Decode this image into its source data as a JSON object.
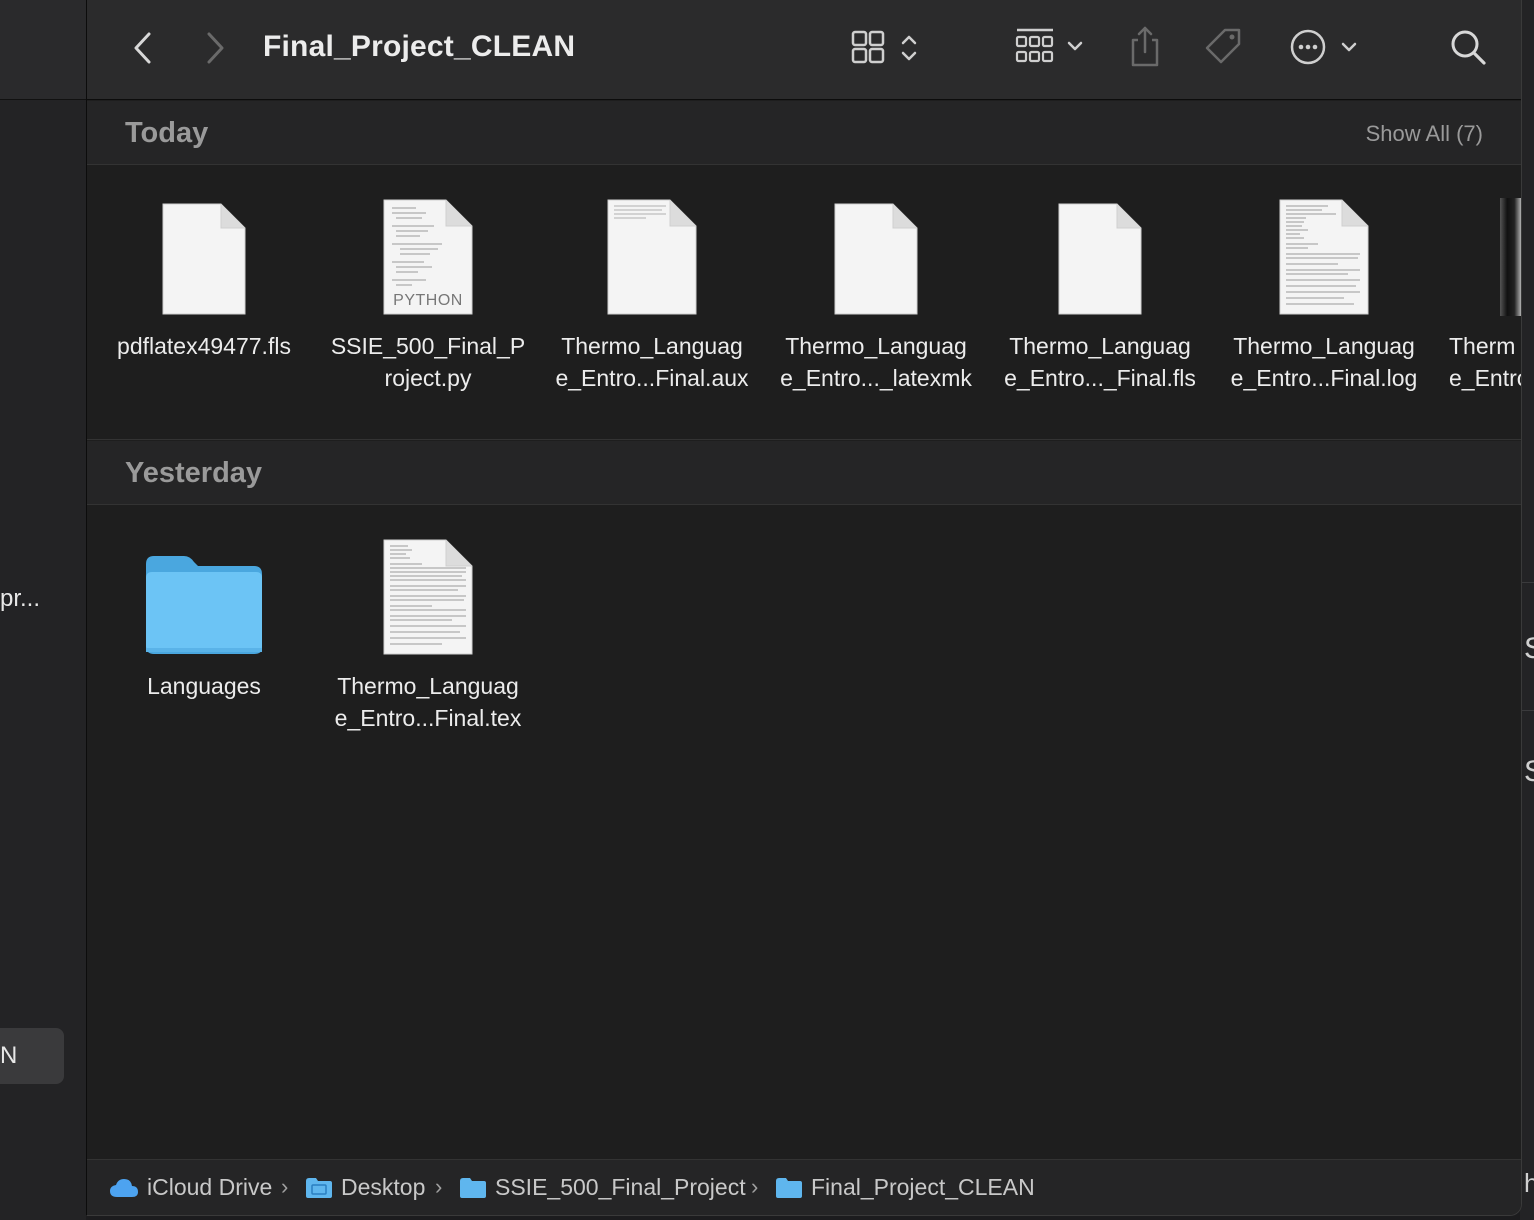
{
  "window": {
    "title": "Final_Project_CLEAN"
  },
  "toolbar": {
    "back": "back-icon",
    "forward": "forward-icon",
    "view_mode": "icon-view-icon",
    "group_by": "group-by-icon",
    "share": "share-icon",
    "tags": "tag-icon",
    "more": "more-icon",
    "search": "search-icon"
  },
  "sections": {
    "today": {
      "label": "Today",
      "show_all": "Show All (7)",
      "items": [
        {
          "line1": "pdflatex49477.fls",
          "line2": "",
          "kind": "blank-doc"
        },
        {
          "line1": "SSIE_500_Final_P",
          "line2": "roject.py",
          "kind": "python-doc",
          "badge": "PYTHON"
        },
        {
          "line1": "Thermo_Languag",
          "line2": "e_Entro...Final.aux",
          "kind": "text-doc"
        },
        {
          "line1": "Thermo_Languag",
          "line2": "e_Entro..._latexmk",
          "kind": "blank-doc"
        },
        {
          "line1": "Thermo_Languag",
          "line2": "e_Entro..._Final.fls",
          "kind": "blank-doc"
        },
        {
          "line1": "Thermo_Languag",
          "line2": "e_Entro...Final.log",
          "kind": "text-doc"
        },
        {
          "line1": "Therm",
          "line2": "e_Entro",
          "kind": "pdf-doc"
        }
      ]
    },
    "yesterday": {
      "label": "Yesterday",
      "items": [
        {
          "line1": "Languages",
          "line2": "",
          "kind": "folder"
        },
        {
          "line1": "Thermo_Languag",
          "line2": "e_Entro...Final.tex",
          "kind": "text-doc"
        }
      ]
    }
  },
  "pathbar": {
    "crumbs": [
      "iCloud Drive",
      "Desktop",
      "SSIE_500_Final_Project",
      "Final_Project_CLEAN"
    ],
    "separator": "›"
  },
  "background": {
    "left_fragment_1": "pr...",
    "left_fragment_2": "N",
    "right_fragment_1": "S",
    "right_fragment_2": "S",
    "right_fragment_3": "h"
  },
  "colors": {
    "folder": "#6cc4f5",
    "window_bg": "#1e1e1e",
    "toolbar_bg": "#2b2b2c"
  }
}
